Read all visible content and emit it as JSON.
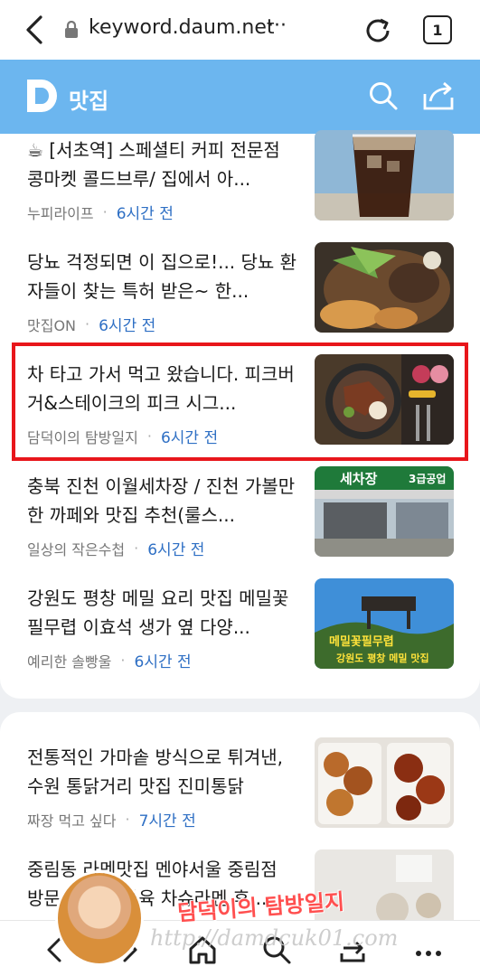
{
  "browser": {
    "url": "keyword.daum.net",
    "url_more": "···",
    "tab_count": "1"
  },
  "header": {
    "title": "맛집",
    "logo_letter": "D",
    "accent_color": "#6cb6ef"
  },
  "articles": [
    {
      "title": "☕ [서초역] 스페셜티 커피 전문점 콩마켓 콜드브루/ 집에서 아...",
      "source": "누피라이프",
      "time": "6시간 전",
      "thumb": "iced-coffee"
    },
    {
      "title": "당뇨 걱정되면 이 집으로!... 당뇨 환자들이 찾는 특허 받은~ 한...",
      "source": "맛집ON",
      "time": "6시간 전",
      "thumb": "hot-pot"
    },
    {
      "title": "차 타고 가서 먹고 왔습니다. 피크버거&스테이크의 피크 시그...",
      "source": "담덕이의 탐방일지",
      "time": "6시간 전",
      "thumb": "steak-plate"
    },
    {
      "title": "충북 진천 이월세차장 / 진천 가볼만 한 까페와 맛집 추천(룰스...",
      "source": "일상의 작은수첩",
      "time": "6시간 전",
      "thumb": "car-wash"
    },
    {
      "title": "강원도 평창 메밀 요리 맛집 메밀꽃필무렵 이효석 생가 옆 다양...",
      "source": "예리한 솔빵울",
      "time": "6시간 전",
      "thumb": "restaurant-sign"
    },
    {
      "title": "전통적인 가마솥 방식으로 튀겨낸, 수원 통닭거리 맛집 진미통닭",
      "source": "짜장 먹고 싶다",
      "time": "7시간 전",
      "thumb": "fried-chicken"
    },
    {
      "title": "중림동 라멘맛집 멘야서울 중림점 방문 후 차슈파육 차슈라멘 후...",
      "source": "",
      "time": "",
      "thumb": "ramen"
    }
  ],
  "thumb_text": {
    "car_wash_sign": "세차장",
    "car_wash_sign2": "3급공업",
    "restaurant_sign1": "메밀꽃필무렵",
    "restaurant_sign2": "강원도 평창 메밀 맛집"
  },
  "watermark": {
    "name": "담덕이의 탐방일지",
    "url": "http://damdcuk01.com"
  },
  "icons": {
    "back": "back-arrow-icon",
    "lock": "lock-icon",
    "reload": "reload-icon",
    "tabs": "tabs-icon",
    "search": "search-icon",
    "share": "share-icon",
    "home": "home-icon",
    "menu": "more-icon"
  },
  "colors": {
    "highlight": "#e8161b",
    "time_text": "#2e6fc4"
  }
}
